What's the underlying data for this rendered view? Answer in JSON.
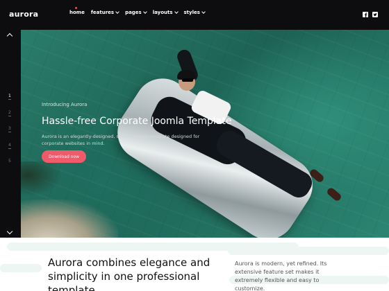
{
  "brand": {
    "logo": "aurora"
  },
  "nav": {
    "items": [
      {
        "label": "home",
        "active": true
      },
      {
        "label": "features",
        "active": false
      },
      {
        "label": "pages",
        "active": false
      },
      {
        "label": "layouts",
        "active": false
      },
      {
        "label": "styles",
        "active": false
      }
    ],
    "social": [
      {
        "name": "facebook-icon",
        "glyph": "f"
      },
      {
        "name": "twitter-icon",
        "glyph": "t"
      }
    ],
    "accent_color": "#ef4a5c"
  },
  "hero": {
    "eyebrow": "Introducing Aurora",
    "headline": "Hassle-free Corporate Joomla Template",
    "description": "Aurora is an elegantly-designed, simple Joomla template designed for corporate websites in mind.",
    "cta_label": "Download now",
    "cta_color": "#ef5b6a"
  },
  "slider": {
    "slides": [
      "1",
      "2",
      "3",
      "4",
      "5"
    ],
    "active_index": 0
  },
  "about": {
    "headline": "Aurora combines elegance and simplicity in one professional template.",
    "text": "Aurora is modern, yet refined. Its extensive feature set makes it extremely flexible and easy to customize."
  }
}
